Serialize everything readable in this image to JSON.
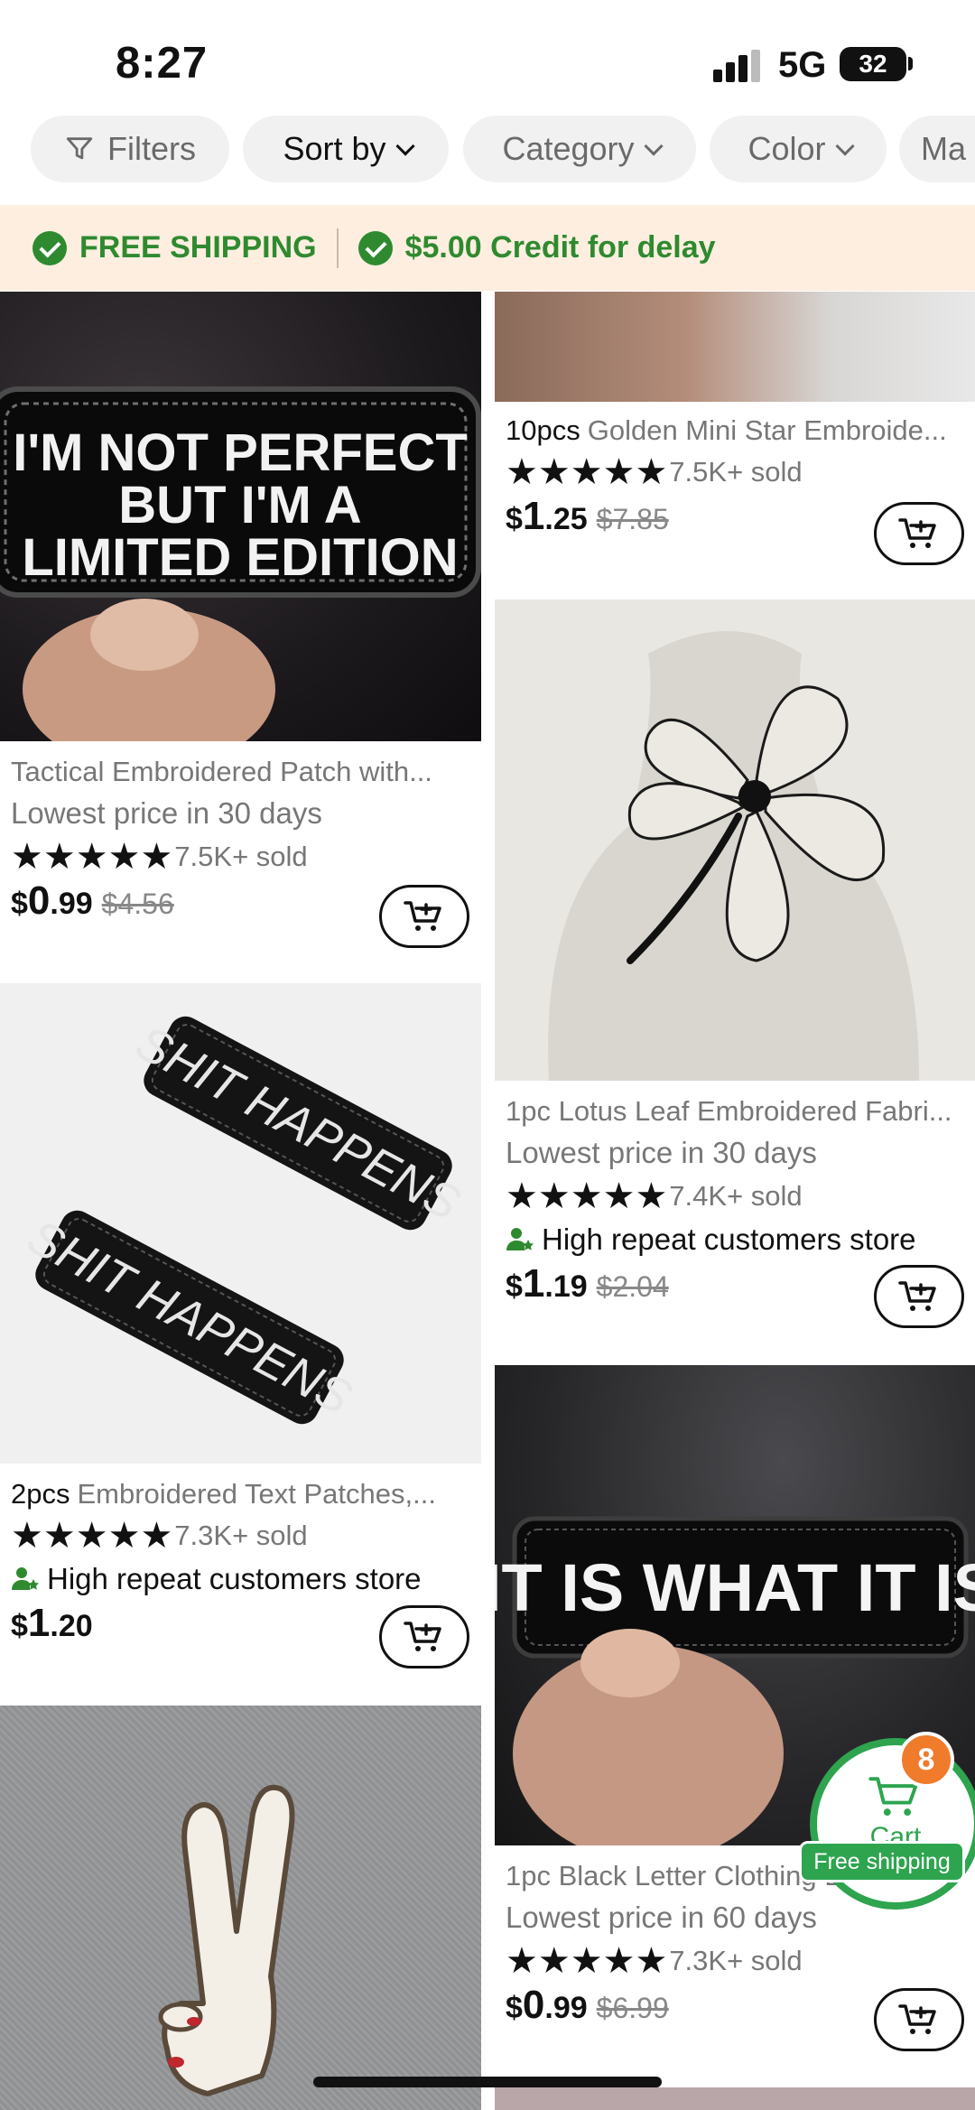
{
  "status_bar": {
    "time": "8:27",
    "network": "5G",
    "battery": "32"
  },
  "filters": [
    {
      "label": "Filters",
      "icon": "funnel-icon"
    },
    {
      "label": "Sort by",
      "icon": "chevron-down-icon"
    },
    {
      "label": "Category",
      "icon": "chevron-down-icon"
    },
    {
      "label": "Color",
      "icon": "chevron-down-icon"
    },
    {
      "label": "Ma"
    }
  ],
  "banner": {
    "free_shipping": "FREE SHIPPING",
    "credit": "$5.00 Credit for delay"
  },
  "products": {
    "left": [
      {
        "image_text": "I'M NOT PERFECT BUT I'M A LIMITED EDITION",
        "title": "Tactical Embroidered Patch with...",
        "note": "Lowest price in 30 days",
        "sold": "7.5K+ sold",
        "price_sign": "$",
        "price_int": "0",
        "price_dec": ".99",
        "old_price": "$4.56"
      },
      {
        "image_text": "SHIT HAPPENS",
        "qty": "2pcs",
        "title": "Embroidered Text Patches,...",
        "sold": "7.3K+ sold",
        "repeat": "High repeat customers store",
        "price_sign": "$",
        "price_int": "1",
        "price_dec": ".20"
      }
    ],
    "right": [
      {
        "qty": "10pcs",
        "title": "Golden Mini Star Embroide...",
        "sold": "7.5K+ sold",
        "price_sign": "$",
        "price_int": "1",
        "price_dec": ".25",
        "old_price": "$7.85"
      },
      {
        "title": "1pc Lotus Leaf Embroidered Fabri...",
        "note": "Lowest price in 30 days",
        "sold": "7.4K+ sold",
        "repeat": "High repeat customers store",
        "price_sign": "$",
        "price_int": "1",
        "price_dec": ".19",
        "old_price": "$2.04"
      },
      {
        "image_text": "IT IS WHAT IT IS",
        "title": "1pc Black Letter Clothing Embroi...",
        "note": "Lowest price in 60 days",
        "sold": "7.3K+ sold",
        "price_sign": "$",
        "price_int": "0",
        "price_dec": ".99",
        "old_price": "$6.99"
      }
    ]
  },
  "floating_cart": {
    "label": "Cart",
    "badge": "8",
    "free_shipping": "Free shipping"
  },
  "colors": {
    "green": "#2f8a2f",
    "banner_bg": "#fdeee0",
    "badge": "#ef7b2b"
  }
}
